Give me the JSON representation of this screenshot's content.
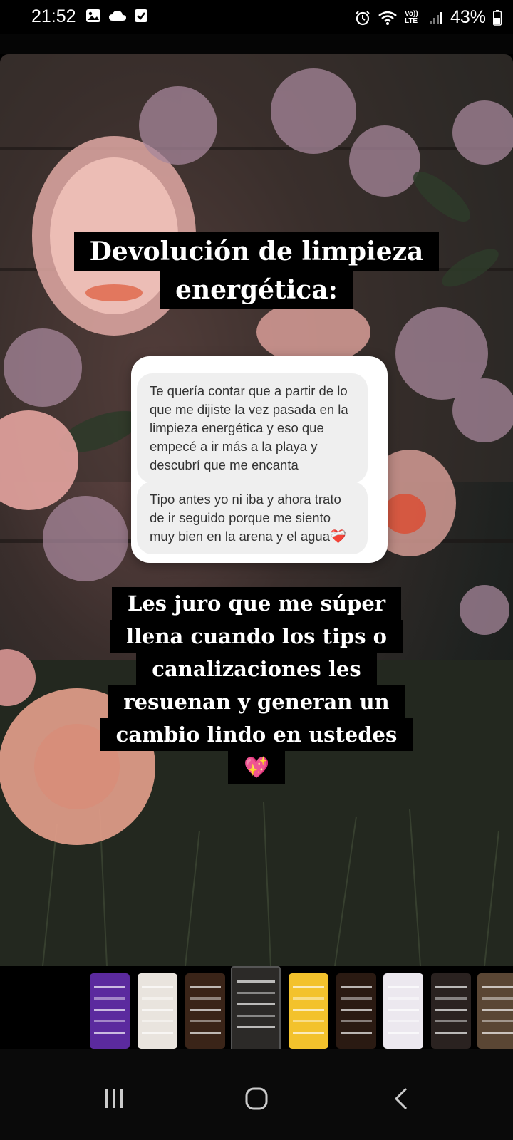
{
  "status_bar": {
    "time": "21:52",
    "battery_percent": "43%",
    "left_icons": [
      "gallery-icon",
      "cloud-icon",
      "check-box-icon"
    ],
    "right_icons": [
      "alarm-icon",
      "wifi-icon",
      "volte-icon",
      "signal-icon",
      "battery-icon"
    ],
    "volte_label": "Vo)) LTE"
  },
  "story": {
    "title_lines": [
      "Devolución de limpieza",
      "energética:"
    ],
    "messages": [
      "Te quería contar que a partir de lo que me dijiste la vez pasada en la limpieza energética y eso que empecé a ir más a la playa y descubrí que me encanta",
      "Tipo antes yo ni iba y ahora trato de ir seguido porque me siento muy bien en la arena y el agua❤️‍🩹"
    ],
    "body_lines": [
      "Les juro que me súper",
      "llena cuando los tips o",
      "canalizaciones les",
      "resuenan y generan un",
      "cambio lindo en ustedes",
      "💖"
    ]
  },
  "thumbnails": {
    "items": [
      {
        "color": "#5b2a9e",
        "active": false
      },
      {
        "color": "#e9e4de",
        "active": false
      },
      {
        "color": "#3a2418",
        "active": false
      },
      {
        "color": "#2c2a28",
        "active": true
      },
      {
        "color": "#f3c22c",
        "active": false
      },
      {
        "color": "#2a1a12",
        "active": false
      },
      {
        "color": "#ece8ef",
        "active": false
      },
      {
        "color": "#2a2220",
        "active": false
      },
      {
        "color": "#5a4634",
        "active": false
      }
    ]
  },
  "nav_bar": {
    "buttons": [
      "recent-apps-icon",
      "home-icon",
      "back-icon"
    ]
  }
}
